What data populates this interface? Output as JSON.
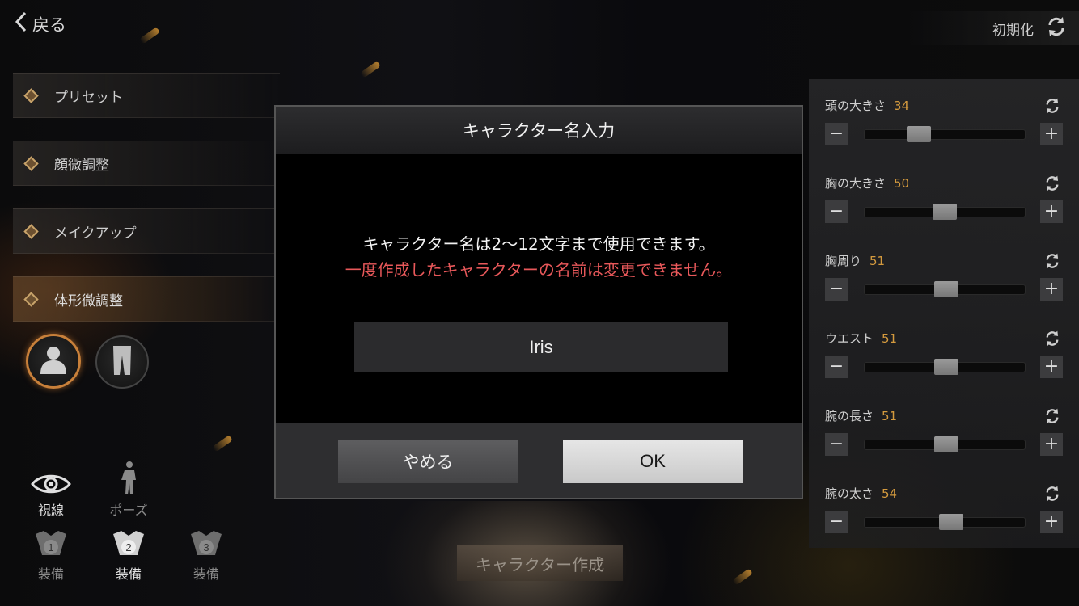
{
  "header": {
    "back_label": "戻る",
    "reset_label": "初期化"
  },
  "menu": {
    "items": [
      {
        "label": "プリセット"
      },
      {
        "label": "顔微調整"
      },
      {
        "label": "メイクアップ"
      },
      {
        "label": "体形微調整"
      }
    ],
    "active_index": 3
  },
  "body_parts": {
    "upper": "upper-body-icon",
    "lower": "pants-icon"
  },
  "tools": {
    "gaze_label": "視線",
    "pose_label": "ポーズ",
    "equip1_label": "装備",
    "equip2_label": "装備",
    "equip3_label": "装備"
  },
  "sliders": [
    {
      "label": "頭の大きさ",
      "value": "34",
      "level": 0.34
    },
    {
      "label": "胸の大きさ",
      "value": "50",
      "level": 0.5
    },
    {
      "label": "胸周り",
      "value": "51",
      "level": 0.51
    },
    {
      "label": "ウエスト",
      "value": "51",
      "level": 0.51
    },
    {
      "label": "腕の長さ",
      "value": "51",
      "level": 0.51
    },
    {
      "label": "腕の太さ",
      "value": "54",
      "level": 0.54
    }
  ],
  "create_button_label": "キャラクター作成",
  "modal": {
    "title": "キャラクター名入力",
    "message": "キャラクター名は2〜12文字まで使用できます。",
    "warning": "一度作成したキャラクターの名前は変更できません。",
    "name_value": "Iris",
    "cancel_label": "やめる",
    "ok_label": "OK"
  },
  "colors": {
    "accent": "#d49a3e",
    "warning": "#e8585a",
    "selected_ring": "#c8803a"
  }
}
